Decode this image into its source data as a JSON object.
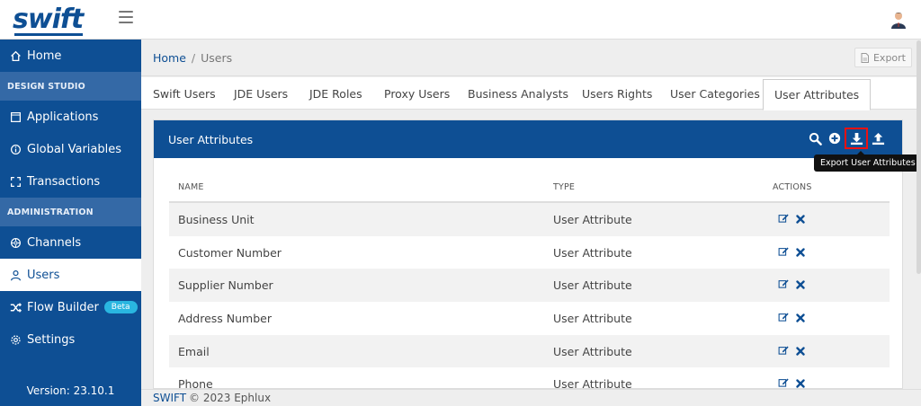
{
  "app": {
    "logo": "swift",
    "version": "Version: 23.10.1"
  },
  "sidebar": {
    "items": [
      {
        "label": "Home",
        "icon": "home-icon"
      },
      {
        "section": "DESIGN STUDIO"
      },
      {
        "label": "Applications",
        "icon": "window-icon"
      },
      {
        "label": "Global Variables",
        "icon": "info-circle-icon"
      },
      {
        "label": "Transactions",
        "icon": "expand-icon"
      },
      {
        "section": "ADMINISTRATION"
      },
      {
        "label": "Channels",
        "icon": "dial-icon"
      },
      {
        "label": "Users",
        "icon": "user-icon",
        "active": true
      },
      {
        "label": "Flow Builder",
        "icon": "shuffle-icon",
        "badge": "Beta"
      },
      {
        "label": "Settings",
        "icon": "gear-icon"
      }
    ]
  },
  "breadcrumb": {
    "home": "Home",
    "sep": "/",
    "current": "Users"
  },
  "export_label": "Export",
  "tabs": [
    {
      "label": "Swift Users"
    },
    {
      "label": "JDE Users"
    },
    {
      "label": "JDE Roles"
    },
    {
      "label": "Proxy Users"
    },
    {
      "label": "Business Analysts"
    },
    {
      "label": "Users Rights"
    },
    {
      "label": "User Categories"
    },
    {
      "label": "User Attributes",
      "active": true
    }
  ],
  "card": {
    "title": "User Attributes",
    "tooltip": "Export User Attributes"
  },
  "table": {
    "headers": [
      "NAME",
      "TYPE",
      "ACTIONS"
    ],
    "rows": [
      {
        "name": "Business Unit",
        "type": "User Attribute"
      },
      {
        "name": "Customer Number",
        "type": "User Attribute"
      },
      {
        "name": "Supplier Number",
        "type": "User Attribute"
      },
      {
        "name": "Address Number",
        "type": "User Attribute"
      },
      {
        "name": "Email",
        "type": "User Attribute"
      },
      {
        "name": "Phone",
        "type": "User Attribute"
      }
    ]
  },
  "footer": {
    "brand": "SWIFT",
    "text": "© 2023 Ephlux"
  },
  "colors": {
    "primary": "#0e4f94",
    "section": "#3469a6",
    "beta": "#29b6e0",
    "highlight": "#e11111"
  }
}
